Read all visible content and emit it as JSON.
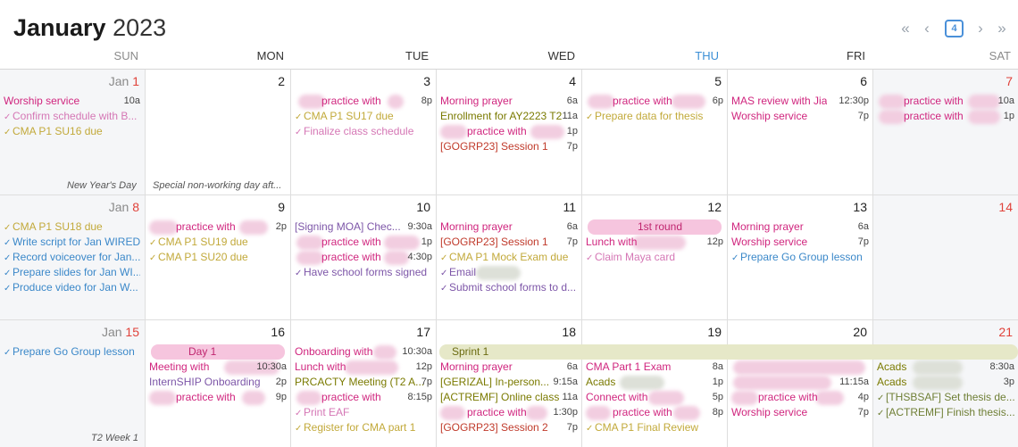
{
  "header": {
    "month": "January",
    "year": "2023",
    "today_badge": "4",
    "nav_first": "«",
    "nav_prev": "‹",
    "nav_next": "›",
    "nav_last": "»"
  },
  "dow": [
    "SUN",
    "MON",
    "TUE",
    "WED",
    "THU",
    "FRI",
    "SAT"
  ],
  "days": {
    "jan1_mon": "Jan ",
    "jan1_num": "1",
    "d2": "2",
    "d3": "3",
    "d4": "4",
    "d5": "5",
    "d6": "6",
    "d7": "7",
    "jan8_mon": "Jan ",
    "jan8_num": "8",
    "d9": "9",
    "d10": "10",
    "d11": "11",
    "d12": "12",
    "d13": "13",
    "d14": "14",
    "jan15_mon": "Jan ",
    "jan15_num": "15",
    "d16": "16",
    "d17": "17",
    "d18": "18",
    "d19": "19",
    "d20": "20",
    "d21": "21"
  },
  "holidays": {
    "h1": "New Year's Day",
    "h2": "Special non-working day aft...",
    "h15": "T2 Week 1"
  },
  "events": {
    "e1a": "Worship service",
    "e1a_t": "10a",
    "e1b": "Confirm schedule with B...",
    "e1c": "CMA P1 SU16 due",
    "e3a": "practice with",
    "e3a_t": "8p",
    "e3b": "CMA P1 SU17 due",
    "e3c": "Finalize class schedule",
    "e4a": "Morning prayer",
    "e4a_t": "6a",
    "e4b": "Enrollment for AY2223 T2",
    "e4b_t": "11a",
    "e4c": "practice with",
    "e4c_t": "1p",
    "e4d": "[GOGRP23] Session 1",
    "e4d_t": "7p",
    "e5a": "practice with",
    "e5a_t": "6p",
    "e5b": "Prepare data for thesis",
    "e6a": "MAS review with Jia",
    "e6a_t": "12:30p",
    "e6b": "Worship service",
    "e6b_t": "7p",
    "e7a": "practice with",
    "e7a_t": "10a",
    "e7b": "practice with",
    "e7b_t": "1p",
    "e8a": "CMA P1 SU18 due",
    "e8b": "Write script for Jan WIRED",
    "e8c": "Record voiceover for Jan...",
    "e8d": "Prepare slides for Jan WI...",
    "e8e": "Produce video for Jan W...",
    "e9a": "practice with",
    "e9a_t": "2p",
    "e9b": "CMA P1 SU19 due",
    "e9c": "CMA P1 SU20 due",
    "e10a": "[Signing MOA] Chec...",
    "e10a_t": "9:30a",
    "e10b": "practice with",
    "e10b_t": "1p",
    "e10c": "practice with",
    "e10c_t": "4:30p",
    "e10d": "Have school forms signed",
    "e11a": "Morning prayer",
    "e11a_t": "6a",
    "e11b": "[GOGRP23] Session 1",
    "e11b_t": "7p",
    "e11c": "CMA P1 Mock Exam due",
    "e11d": "Email",
    "e11e": "Submit school forms to d...",
    "e12a": "1st round",
    "e12b": "Lunch with",
    "e12b_t": "12p",
    "e12c": "Claim Maya card",
    "e13a": "Morning prayer",
    "e13a_t": "6a",
    "e13b": "Worship service",
    "e13b_t": "7p",
    "e13c": "Prepare Go Group lesson",
    "e15a": "Prepare Go Group lesson",
    "e16bar": "Day 1",
    "e16a": "Meeting with",
    "e16a_t": "10:30a",
    "e16b": "InternSHIP Onboarding",
    "e16b_t": "2p",
    "e16c": "practice with",
    "e16c_t": "9p",
    "e17a": "Onboarding with",
    "e17a_t": "10:30a",
    "e17b": "Lunch with",
    "e17b_t": "12p",
    "e17c": "PRCACTY Meeting (T2 A...",
    "e17c_t": "7p",
    "e17d": "practice with",
    "e17d_t": "8:15p",
    "e17e": "Print EAF",
    "e17f": "Register for CMA part 1",
    "sprint": "Sprint 1",
    "e18a": "Morning prayer",
    "e18a_t": "6a",
    "e18b": "[GERIZAL] In-person...",
    "e18b_t": "9:15a",
    "e18c": "[ACTREMF] Online class",
    "e18c_t": "11a",
    "e18d": "practice with",
    "e18d_t": "1:30p",
    "e18e": "[GOGRP23] Session 2",
    "e18e_t": "7p",
    "e19a": "CMA Part 1 Exam",
    "e19a_t": "8a",
    "e19b": "Acads",
    "e19b_t": "1p",
    "e19c": "Connect with",
    "e19c_t": "5p",
    "e19d": "practice with",
    "e19d_t": "8p",
    "e19e": "CMA P1 Final Review",
    "e20a": "11:15a",
    "e20b": "practice with",
    "e20b_t": "4p",
    "e20c": "Worship service",
    "e20c_t": "7p",
    "e21a": "Acads",
    "e21a_t": "8:30a",
    "e21b": "Acads",
    "e21b_t": "3p",
    "e21c": "[THSBSAF] Set thesis de...",
    "e21d": "[ACTREMF] Finish thesis..."
  },
  "colors": {
    "today": "#3b8fd6",
    "holiday_red": "#e0423a",
    "sprint_bar": "#e6e8c8",
    "day1_bar": "#f6b8d6"
  }
}
